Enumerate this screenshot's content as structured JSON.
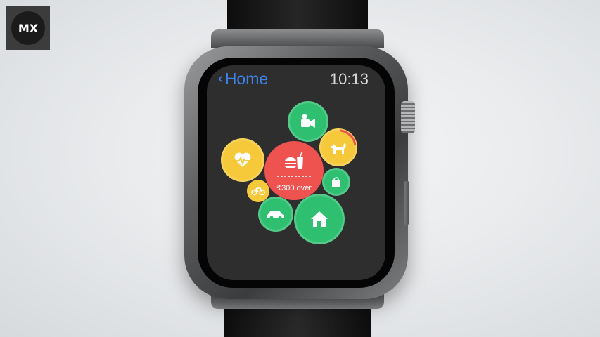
{
  "brand": {
    "logo_text": "MX"
  },
  "watch": {
    "nav": {
      "back_label": "Home",
      "back_icon": "chevron-left-icon"
    },
    "time": "10:13",
    "categories": [
      {
        "name": "video",
        "icon": "video-camera-icon",
        "color": "#2fbf71"
      },
      {
        "name": "pets",
        "icon": "dog-icon",
        "color": "#f5c93a"
      },
      {
        "name": "health",
        "icon": "heart-pulse-icon",
        "color": "#f5c93a"
      },
      {
        "name": "food",
        "icon": "food-drink-icon",
        "color": "#ef5350",
        "status": "₹300 over"
      },
      {
        "name": "shopping",
        "icon": "shopping-bag-icon",
        "color": "#2fbf71"
      },
      {
        "name": "cycling",
        "icon": "bicycle-icon",
        "color": "#f5c93a"
      },
      {
        "name": "transport",
        "icon": "car-icon",
        "color": "#2fbf71"
      },
      {
        "name": "home",
        "icon": "house-icon",
        "color": "#2fbf71"
      }
    ]
  }
}
